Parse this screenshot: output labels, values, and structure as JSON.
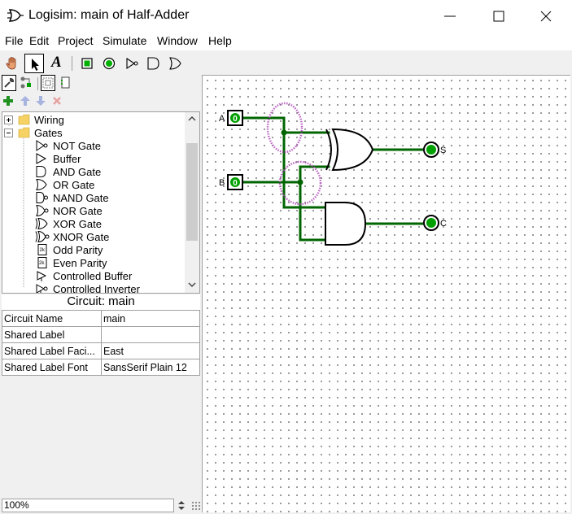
{
  "window": {
    "title": "Logisim: main of Half-Adder"
  },
  "menu": [
    "File",
    "Edit",
    "Project",
    "Simulate",
    "Window",
    "Help"
  ],
  "toolbar": {
    "tools": [
      {
        "name": "poke-tool",
        "icon": "hand-icon"
      },
      {
        "name": "select-tool",
        "icon": "arrow-icon",
        "selected": true
      },
      {
        "name": "text-tool",
        "icon": "text-A-icon"
      },
      {
        "name": "input-pin-tool",
        "icon": "input-pin-icon"
      },
      {
        "name": "output-pin-tool",
        "icon": "output-pin-icon"
      },
      {
        "name": "not-gate-tool",
        "icon": "not-gate-icon"
      },
      {
        "name": "and-gate-tool",
        "icon": "and-gate-icon"
      },
      {
        "name": "or-gate-tool",
        "icon": "or-gate-icon"
      }
    ],
    "text_tool_label": "A"
  },
  "explorer": {
    "folders": [
      {
        "label": "Wiring",
        "expanded": false
      },
      {
        "label": "Gates",
        "expanded": true
      }
    ],
    "gates": [
      "NOT Gate",
      "Buffer",
      "AND Gate",
      "OR Gate",
      "NAND Gate",
      "NOR Gate",
      "XOR Gate",
      "XNOR Gate",
      "Odd Parity",
      "Even Parity",
      "Controlled Buffer",
      "Controlled Inverter"
    ]
  },
  "attributes": {
    "title": "Circuit: main",
    "rows": [
      {
        "key": "Circuit Name",
        "value": "main"
      },
      {
        "key": "Shared Label",
        "value": ""
      },
      {
        "key": "Shared Label Faci...",
        "value": "East"
      },
      {
        "key": "Shared Label Font",
        "value": "SansSerif Plain 12"
      }
    ]
  },
  "zoom": "100%",
  "circuit": {
    "inputs": [
      {
        "label": "A",
        "value": "0"
      },
      {
        "label": "B",
        "value": "0"
      }
    ],
    "outputs": [
      {
        "label": "S"
      },
      {
        "label": "C"
      }
    ],
    "gates": [
      "XOR",
      "AND"
    ],
    "colors": {
      "wire_low": "#006400",
      "highlight_circle": "#b04ab8",
      "pin_fill": "#00a000"
    }
  }
}
